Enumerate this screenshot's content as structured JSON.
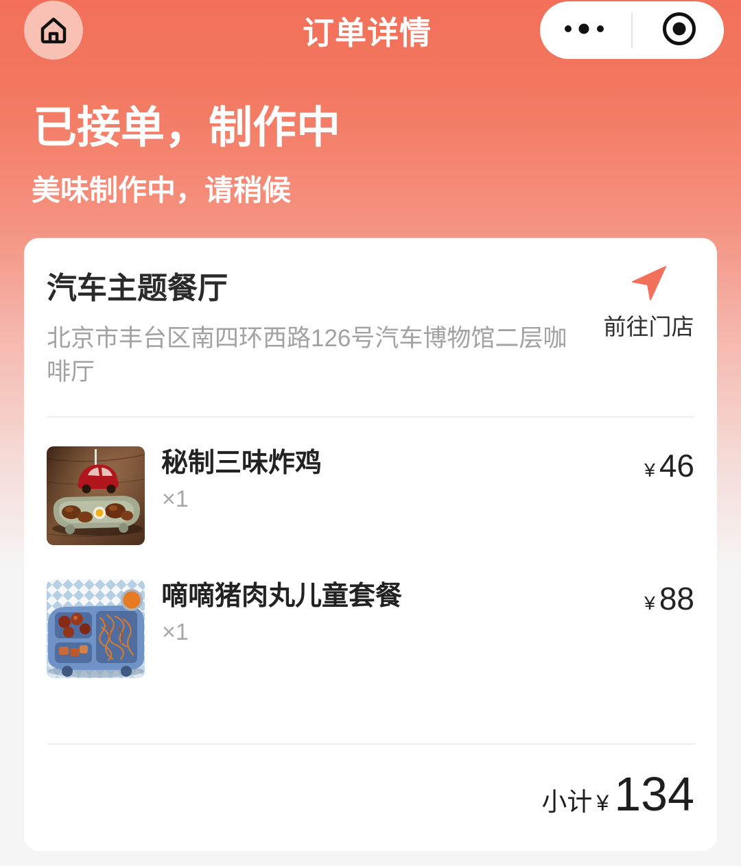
{
  "header": {
    "title": "订单详情",
    "home_icon": "home-icon",
    "more_icon": "more-dots-icon",
    "target_icon": "target-icon"
  },
  "status": {
    "title": "已接单，制作中",
    "subtitle": "美味制作中，请稍候"
  },
  "store": {
    "name": "汽车主题餐厅",
    "address": "北京市丰台区南四环西路126号汽车博物馆二层咖啡厅",
    "nav_label": "前往门店",
    "nav_icon": "navigation-arrow-icon"
  },
  "items": [
    {
      "name": "秘制三味炸鸡",
      "quantity": "×1",
      "currency": "¥",
      "price": "46"
    },
    {
      "name": "嘀嘀猪肉丸儿童套餐",
      "quantity": "×1",
      "currency": "¥",
      "price": "88"
    }
  ],
  "subtotal": {
    "label": "小计",
    "currency": "¥",
    "amount": "134"
  },
  "colors": {
    "accent": "#F2715B",
    "text_primary": "#222222",
    "text_secondary": "#A2A2A2",
    "page_background": "#F5F5F5"
  }
}
